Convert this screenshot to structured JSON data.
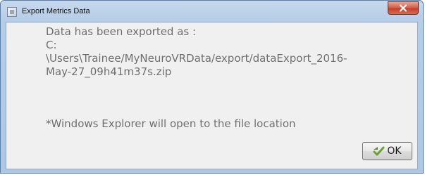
{
  "window": {
    "title": "Export Metrics Data",
    "icons": {
      "app": "app-window-icon",
      "close": "close-icon",
      "ok": "check-arrow-icon"
    }
  },
  "message": {
    "lines": [
      "Data has been exported as :",
      "C:",
      "\\Users\\Trainee/MyNeuroVRData/export/dataExport_2016-",
      "May-27_09h41m37s.zip"
    ],
    "note": "*Windows Explorer will open to the file location"
  },
  "buttons": {
    "ok_label": "OK"
  },
  "colors": {
    "close": "#c5402a",
    "text": "#6f6f6f",
    "client_bg": "#f0f0f0",
    "ok_icon": "#6aa032"
  }
}
